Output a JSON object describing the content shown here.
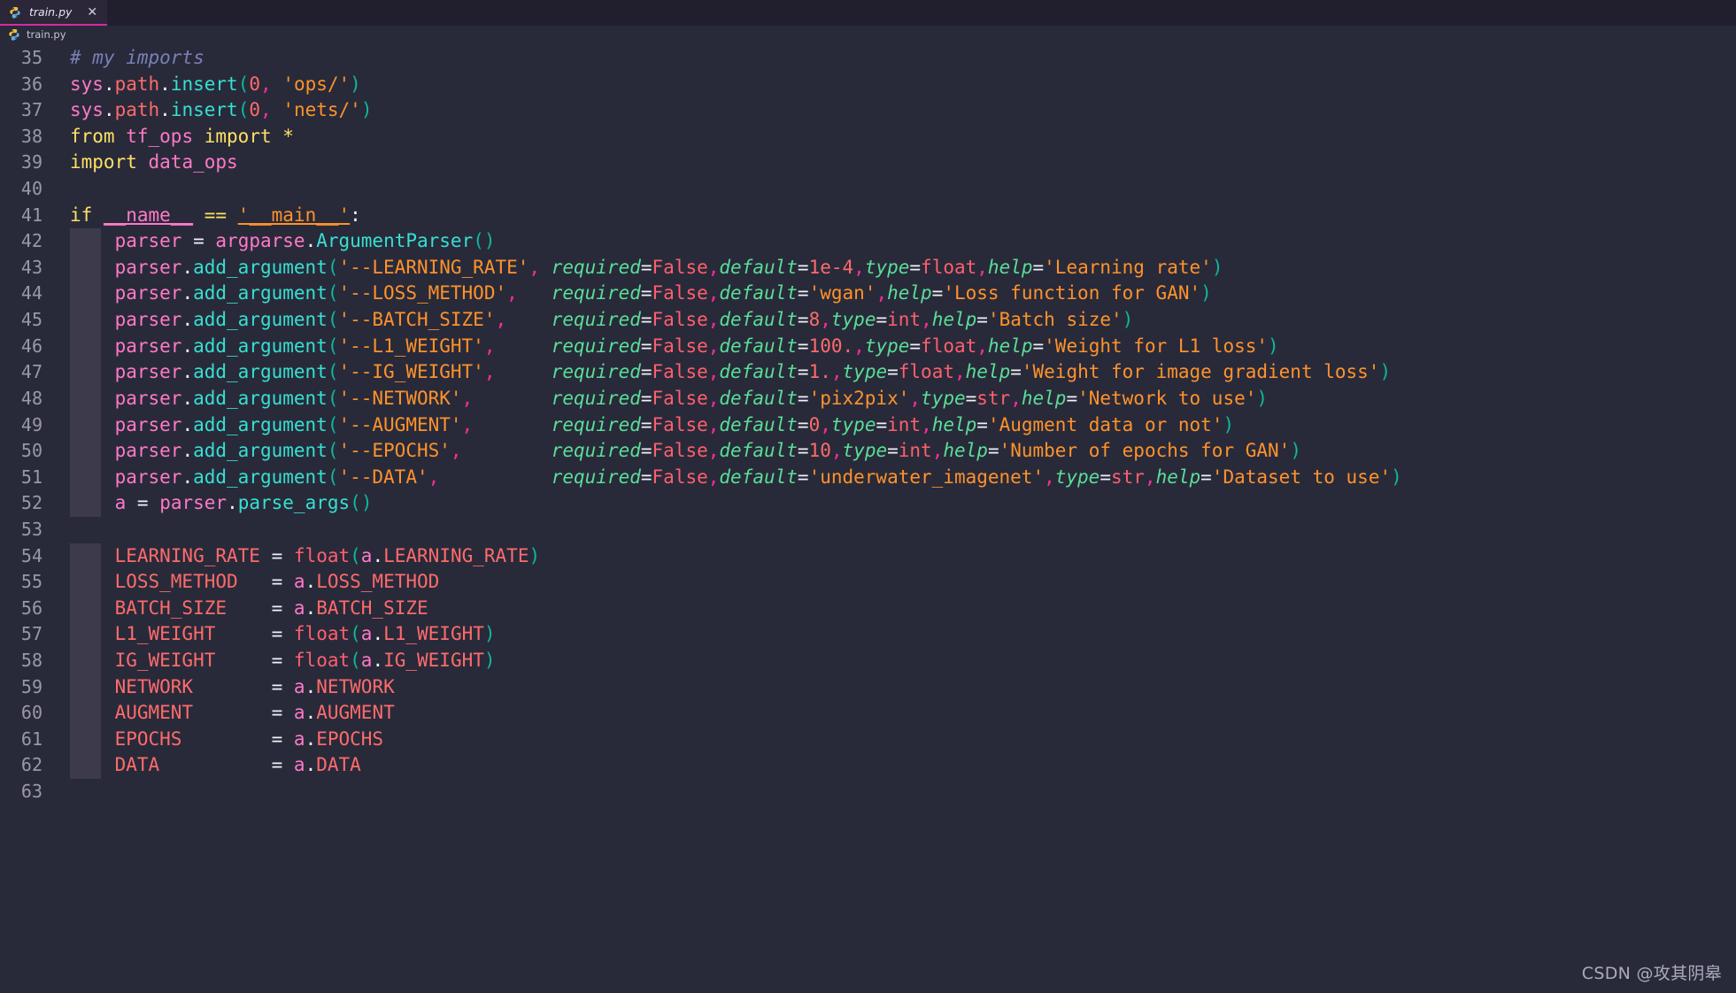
{
  "window": {
    "background_color": "#282a3a",
    "tabbar_color": "#211f2e"
  },
  "tabbar": {
    "tabs": [
      {
        "label": "train.py",
        "icon": "python-icon",
        "close_label": "✕",
        "active": true,
        "accent_color": "#d62aa0"
      }
    ]
  },
  "breadcrumb": {
    "icon": "python-icon",
    "path": "train.py"
  },
  "editor": {
    "first_visible_line": 35,
    "last_visible_line": 63,
    "language": "Python",
    "theme_accent": "#ff79c6",
    "lines": [
      {
        "n": "35",
        "indent": 0,
        "text": "# my imports"
      },
      {
        "n": "36",
        "indent": 0,
        "text": "sys.path.insert(0, 'ops/')"
      },
      {
        "n": "37",
        "indent": 0,
        "text": "sys.path.insert(0, 'nets/')"
      },
      {
        "n": "38",
        "indent": 0,
        "text": "from tf_ops import *"
      },
      {
        "n": "39",
        "indent": 0,
        "text": "import data_ops"
      },
      {
        "n": "40",
        "indent": 0,
        "text": ""
      },
      {
        "n": "41",
        "indent": 0,
        "text": "if __name__ == '__main__':"
      },
      {
        "n": "42",
        "indent": 1,
        "text": "parser = argparse.ArgumentParser()"
      },
      {
        "n": "43",
        "indent": 1,
        "text": "parser.add_argument('--LEARNING_RATE', required=False,default=1e-4,type=float,help='Learning rate')"
      },
      {
        "n": "44",
        "indent": 1,
        "text": "parser.add_argument('--LOSS_METHOD',   required=False,default='wgan',help='Loss function for GAN')"
      },
      {
        "n": "45",
        "indent": 1,
        "text": "parser.add_argument('--BATCH_SIZE',    required=False,default=8,type=int,help='Batch size')"
      },
      {
        "n": "46",
        "indent": 1,
        "text": "parser.add_argument('--L1_WEIGHT',     required=False,default=100.,type=float,help='Weight for L1 loss')"
      },
      {
        "n": "47",
        "indent": 1,
        "text": "parser.add_argument('--IG_WEIGHT',     required=False,default=1.,type=float,help='Weight for image gradient loss')"
      },
      {
        "n": "48",
        "indent": 1,
        "text": "parser.add_argument('--NETWORK',       required=False,default='pix2pix',type=str,help='Network to use')"
      },
      {
        "n": "49",
        "indent": 1,
        "text": "parser.add_argument('--AUGMENT',       required=False,default=0,type=int,help='Augment data or not')"
      },
      {
        "n": "50",
        "indent": 1,
        "text": "parser.add_argument('--EPOCHS',        required=False,default=10,type=int,help='Number of epochs for GAN')"
      },
      {
        "n": "51",
        "indent": 1,
        "text": "parser.add_argument('--DATA',          required=False,default='underwater_imagenet',type=str,help='Dataset to use')"
      },
      {
        "n": "52",
        "indent": 1,
        "text": "a = parser.parse_args()"
      },
      {
        "n": "53",
        "indent": 0,
        "text": ""
      },
      {
        "n": "54",
        "indent": 1,
        "text": "LEARNING_RATE = float(a.LEARNING_RATE)"
      },
      {
        "n": "55",
        "indent": 1,
        "text": "LOSS_METHOD   = a.LOSS_METHOD"
      },
      {
        "n": "56",
        "indent": 1,
        "text": "BATCH_SIZE    = a.BATCH_SIZE"
      },
      {
        "n": "57",
        "indent": 1,
        "text": "L1_WEIGHT     = float(a.L1_WEIGHT)"
      },
      {
        "n": "58",
        "indent": 1,
        "text": "IG_WEIGHT     = float(a.IG_WEIGHT)"
      },
      {
        "n": "59",
        "indent": 1,
        "text": "NETWORK       = a.NETWORK"
      },
      {
        "n": "60",
        "indent": 1,
        "text": "AUGMENT       = a.AUGMENT"
      },
      {
        "n": "61",
        "indent": 1,
        "text": "EPOCHS        = a.EPOCHS"
      },
      {
        "n": "62",
        "indent": 1,
        "text": "DATA          = a.DATA"
      },
      {
        "n": "63",
        "indent": 0,
        "text": ""
      }
    ]
  },
  "watermark": {
    "text": "CSDN @攻其阴皋"
  }
}
